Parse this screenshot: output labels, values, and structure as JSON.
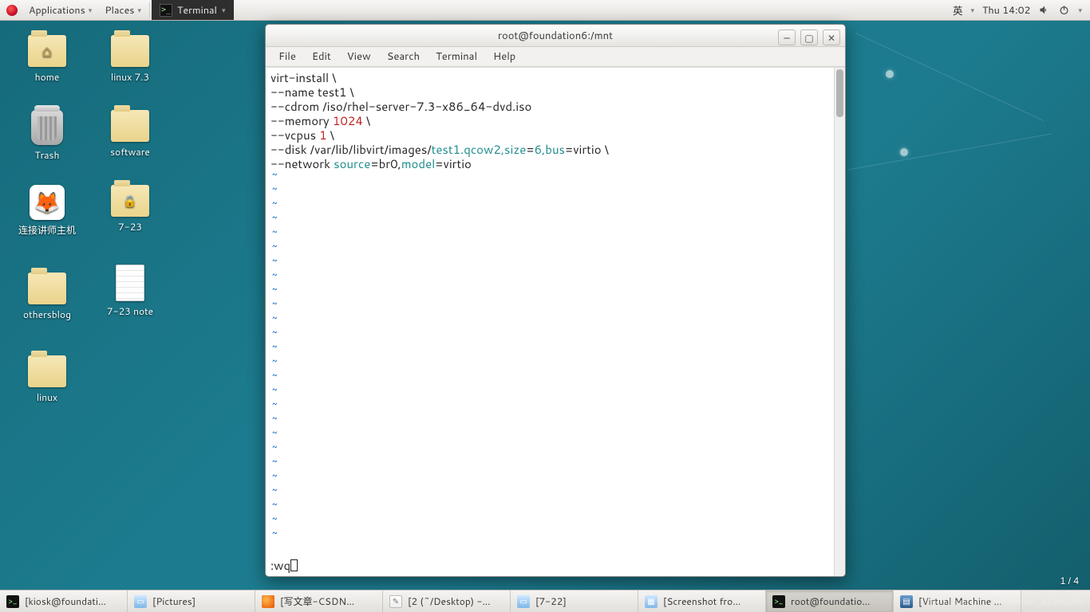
{
  "top_panel": {
    "applications": "Applications",
    "places": "Places",
    "running_task": "Terminal",
    "ime": "英",
    "clock": "Thu 14:02"
  },
  "desktop_icons": {
    "home": "home",
    "trash": "Trash",
    "connect_teacher": "连接讲师主机",
    "othersblog": "othersblog",
    "linux": "linux",
    "linux73": "linux 7.3",
    "software": "software",
    "note723_folder": "7-23",
    "note723_file": "7-23 note"
  },
  "terminal": {
    "title": "root@foundation6:/mnt",
    "menus": [
      "File",
      "Edit",
      "View",
      "Search",
      "Terminal",
      "Help"
    ],
    "cmdline": ":wq",
    "content": {
      "l1a": "virt-install \\",
      "l2a": "--name test1 \\",
      "l3a": "--cdrom /iso/rhel-server-7.3-x86_64-dvd.iso",
      "l4a": "--memory ",
      "l4b": "1024",
      "l4c": " \\",
      "l5a": "--vcpus ",
      "l5b": "1",
      "l5c": " \\",
      "l6a": "--disk /var/lib/libvirt/images/",
      "l6b": "test1.qcow2,size",
      "l6c": "=",
      "l6d": "6,bus",
      "l6e": "=virtio \\",
      "l7a": "--network ",
      "l7b": "source",
      "l7c": "=br0,",
      "l7d": "model",
      "l7e": "=virtio"
    }
  },
  "taskbar": [
    {
      "label": "[kiosk@foundati…",
      "icon": "tm"
    },
    {
      "label": "[Pictures]",
      "icon": "fm"
    },
    {
      "label": "[写文章-CSDN…",
      "icon": "ff"
    },
    {
      "label": "[2 (~/Desktop) -…",
      "icon": "ed"
    },
    {
      "label": "[7-22]",
      "icon": "fm"
    },
    {
      "label": "[Screenshot fro…",
      "icon": "fm"
    },
    {
      "label": "root@foundatio…",
      "icon": "tm",
      "active": true
    },
    {
      "label": "[Virtual Machine …",
      "icon": "vm"
    }
  ],
  "misc": {
    "watermark": "https://blog.csdn.net/weixin_42996595",
    "page_of": "1 / 4"
  }
}
